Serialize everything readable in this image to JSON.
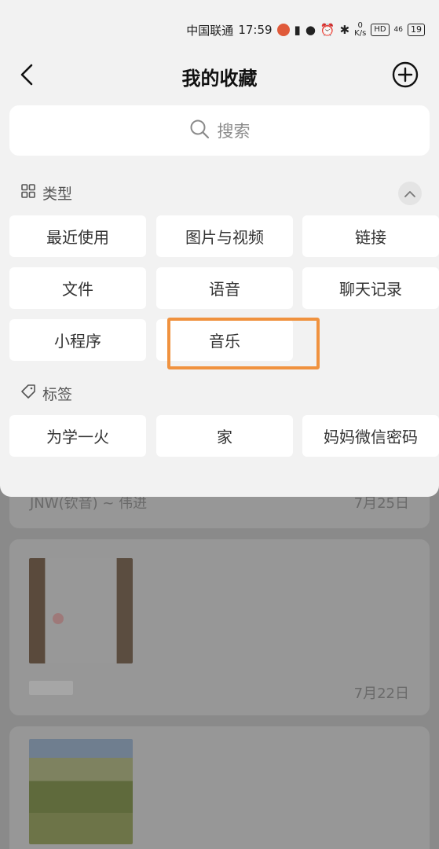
{
  "status_bar": {
    "carrier": "中国联通",
    "time": "17:59",
    "net_speed_value": "0",
    "net_speed_unit": "K/s",
    "hd": "HD",
    "signal": "46",
    "battery": "19"
  },
  "header": {
    "title": "我的收藏"
  },
  "search": {
    "placeholder": "搜索"
  },
  "type_section": {
    "title": "类型",
    "items": [
      "最近使用",
      "图片与视频",
      "链接",
      "文件",
      "语音",
      "聊天记录",
      "小程序",
      "音乐"
    ],
    "highlighted_item": "音乐"
  },
  "tag_section": {
    "title": "标签",
    "items": [
      "为学一火",
      "家",
      "妈妈微信密码"
    ]
  },
  "background_list": {
    "items": [
      {
        "source": "JNW(钦音) ~ 伟进",
        "date": "7月25日"
      },
      {
        "source": "",
        "date": "7月22日"
      }
    ]
  },
  "colors": {
    "highlight": "#f0923f",
    "sheet_bg": "#f2f2f2"
  }
}
